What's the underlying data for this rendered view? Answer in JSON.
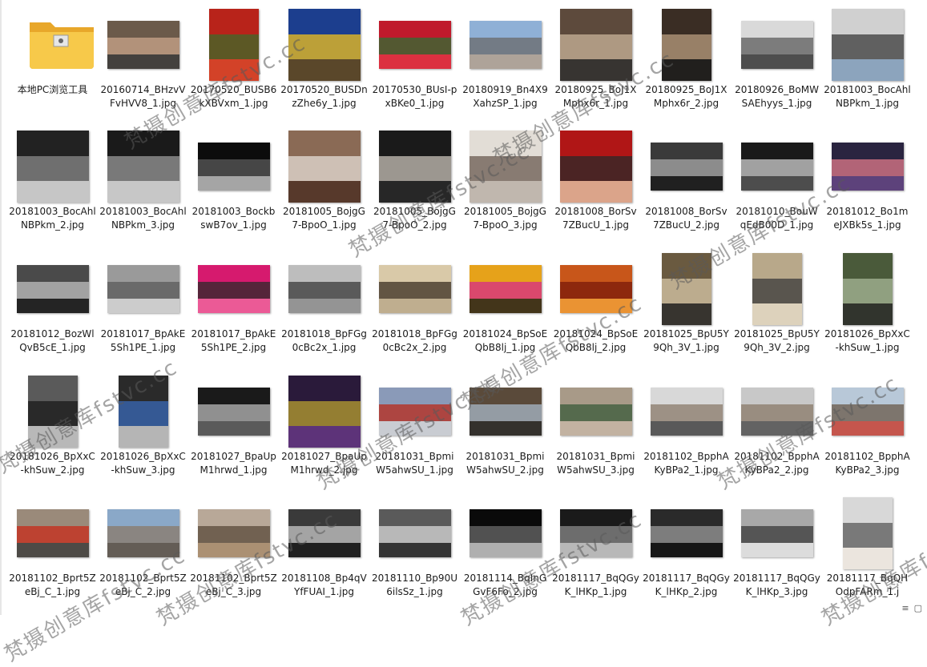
{
  "files": [
    {
      "label": "本地PC浏览工具",
      "kind": "folder"
    },
    {
      "label": "20160714_BHzvVFvHVV8_1.jpg",
      "colors": [
        "#6b5a4a",
        "#c9a58b",
        "#3b3b3b"
      ]
    },
    {
      "label": "20170520_BUSB6kXBVxm_1.jpg",
      "colors": [
        "#b8231a",
        "#3e6b2a",
        "#d94a2c"
      ]
    },
    {
      "label": "20170520_BUSDnzZhe6y_1.jpg",
      "colors": [
        "#1c3e8e",
        "#f2c21b",
        "#6a4a12"
      ]
    },
    {
      "label": "20170530_BUsI-pxBKe0_1.jpg",
      "colors": [
        "#c01a2c",
        "#2f6d33",
        "#e23646"
      ]
    },
    {
      "label": "20180919_Bn4X9XahzSP_1.jpg",
      "colors": [
        "#8fb0d6",
        "#6a6a6a",
        "#b5a089"
      ]
    },
    {
      "label": "20180925_BoJ1XMphx6r_1.jpg",
      "colors": [
        "#5d4a3c",
        "#c9b49a",
        "#2e2e2e"
      ]
    },
    {
      "label": "20180925_BoJ1XMphx6r_2.jpg",
      "colors": [
        "#3a2d24",
        "#b89c7e",
        "#1c1c1c"
      ]
    },
    {
      "label": "20180926_BoMWSAEhyys_1.jpg",
      "colors": [
        "#d9d9d9",
        "#5c5c5c",
        "#2a2a2a"
      ]
    },
    {
      "label": "20181003_BocAhlNBPkm_1.jpg",
      "colors": [
        "#d0d0d0",
        "#3b3b3b",
        "#7a98b8"
      ]
    },
    {
      "label": "20181003_BocAhlNBPkm_2.jpg",
      "colors": [
        "#222222",
        "#8a8a8a",
        "#f0f0f0"
      ]
    },
    {
      "label": "20181003_BocAhlNBPkm_3.jpg",
      "colors": [
        "#1a1a1a",
        "#9a9a9a",
        "#f2f2f2"
      ]
    },
    {
      "label": "20181003_BockbswB7ov_1.jpg",
      "colors": [
        "#0c0c0c",
        "#5a5a5a",
        "#cccccc"
      ]
    },
    {
      "label": "20181005_BojgG7-BpoO_1.jpg",
      "colors": [
        "#8a6a55",
        "#e4ddd5",
        "#4a2d20"
      ]
    },
    {
      "label": "20181005_BojgG7-BpoO_2.jpg",
      "colors": [
        "#1a1a1a",
        "#c8c2b8",
        "#2b2b2b"
      ]
    },
    {
      "label": "20181005_BojgG7-BpoO_3.jpg",
      "colors": [
        "#e2ddd6",
        "#6a5a50",
        "#b8aea4"
      ]
    },
    {
      "label": "20181008_BorSv7ZBucU_1.jpg",
      "colors": [
        "#b01616",
        "#2a2a2a",
        "#e6c8a8"
      ]
    },
    {
      "label": "20181008_BorSv7ZBucU_2.jpg",
      "colors": [
        "#3a3a3a",
        "#a8a8a8",
        "#1a1a1a"
      ]
    },
    {
      "label": "20181010_BouWqEdB00D_1.jpg",
      "colors": [
        "#1a1a1a",
        "#cfcfcf",
        "#5a5a5a"
      ]
    },
    {
      "label": "20181012_Bo1meJXBk5s_1.jpg",
      "colors": [
        "#2a2440",
        "#e07a8a",
        "#6a4a8a"
      ]
    },
    {
      "label": "20181012_BozWlQvB5cE_1.jpg",
      "colors": [
        "#4a4a4a",
        "#c0c0c0",
        "#1a1a1a"
      ]
    },
    {
      "label": "20181017_BpAkE5Sh1PE_1.jpg",
      "colors": [
        "#9a9a9a",
        "#5a5a5a",
        "#d8d8d8"
      ]
    },
    {
      "label": "20181017_BpAkE5Sh1PE_2.jpg",
      "colors": [
        "#d61a6e",
        "#2a2a2a",
        "#f06aa0"
      ]
    },
    {
      "label": "20181018_BpFGg0cBc2x_1.jpg",
      "colors": [
        "#bdbdbd",
        "#3a3a3a",
        "#8a8a8a"
      ]
    },
    {
      "label": "20181018_BpFGg0cBc2x_2.jpg",
      "colors": [
        "#d9c9a8",
        "#3a2e22",
        "#b8a888"
      ]
    },
    {
      "label": "20181024_BpSoEQbB8lj_1.jpg",
      "colors": [
        "#e6a21a",
        "#d62a8a",
        "#1a1a1a"
      ]
    },
    {
      "label": "20181024_BpSoEQbB8lj_2.jpg",
      "colors": [
        "#c8561a",
        "#7a1a0a",
        "#f2a23a"
      ]
    },
    {
      "label": "20181025_BpU5Y9Qh_3V_1.jpg",
      "colors": [
        "#6a5a40",
        "#d8c8a8",
        "#2a2a2a"
      ]
    },
    {
      "label": "20181025_BpU5Y9Qh_3V_2.jpg",
      "colors": [
        "#b8a88a",
        "#3a3a3a",
        "#e6dcc8"
      ]
    },
    {
      "label": "20181026_BpXxC-khSuw_1.jpg",
      "colors": [
        "#4a5a3a",
        "#a8b898",
        "#2a2a2a"
      ]
    },
    {
      "label": "20181026_BpXxC-khSuw_2.jpg",
      "colors": [
        "#5a5a5a",
        "#1a1a1a",
        "#cfcfcf"
      ]
    },
    {
      "label": "20181026_BpXxC-khSuw_3.jpg",
      "colors": [
        "#2a2a2a",
        "#3a6ab8",
        "#d8d8d8"
      ]
    },
    {
      "label": "20181027_BpaUpM1hrwd_1.jpg",
      "colors": [
        "#1a1a1a",
        "#b8b8b8",
        "#6a6a6a"
      ]
    },
    {
      "label": "20181027_BpaUpM1hrwd_2.jpg",
      "colors": [
        "#2a1a3a",
        "#b8a030",
        "#6a3a8a"
      ]
    },
    {
      "label": "20181031_BpmiW5ahwSU_1.jpg",
      "colors": [
        "#8a9ab8",
        "#b8281a",
        "#d8d8d8"
      ]
    },
    {
      "label": "20181031_BpmiW5ahwSU_2.jpg",
      "colors": [
        "#5a4a3a",
        "#a8b8c8",
        "#2a2a2a"
      ]
    },
    {
      "label": "20181031_BpmiW5ahwSU_3.jpg",
      "colors": [
        "#a89a88",
        "#3a5a3a",
        "#c8b8a8"
      ]
    },
    {
      "label": "20181102_BpphAKyBPa2_1.jpg",
      "colors": [
        "#d8d8d8",
        "#8a7a6a",
        "#3a3a3a"
      ]
    },
    {
      "label": "20181102_BpphAKyBPa2_2.jpg",
      "colors": [
        "#c8c8c8",
        "#8a7a68",
        "#4a4a4a"
      ]
    },
    {
      "label": "20181102_BpphAKyBPa2_3.jpg",
      "colors": [
        "#b8c8d8",
        "#6a5a4a",
        "#c83a2a"
      ]
    },
    {
      "label": "20181102_Bprt5ZeBj_C_1.jpg",
      "colors": [
        "#9a8a7a",
        "#c82a1a",
        "#3a3a3a"
      ]
    },
    {
      "label": "20181102_Bprt5ZeBj_C_2.jpg",
      "colors": [
        "#8aa8c8",
        "#8a7a6a",
        "#5a4a3a"
      ]
    },
    {
      "label": "20181102_Bprt5ZeBj_C_3.jpg",
      "colors": [
        "#b8a898",
        "#5a4a3a",
        "#a88a6a"
      ]
    },
    {
      "label": "20181108_Bp4qVYfFUAI_1.jpg",
      "colors": [
        "#3a3a3a",
        "#c8c8c8",
        "#1a1a1a"
      ]
    },
    {
      "label": "20181110_Bp90U6ilsSz_1.jpg",
      "colors": [
        "#5a5a5a",
        "#d8d8d8",
        "#2a2a2a"
      ]
    },
    {
      "label": "20181114_BqInGGvF6Fo_2.jpg",
      "colors": [
        "#0a0a0a",
        "#6a6a6a",
        "#d8d8d8"
      ]
    },
    {
      "label": "20181117_BqQGyK_lHKp_1.jpg",
      "colors": [
        "#1a1a1a",
        "#8a8a8a",
        "#e0e0e0"
      ]
    },
    {
      "label": "20181117_BqQGyK_lHKp_2.jpg",
      "colors": [
        "#2a2a2a",
        "#9a9a9a",
        "#111111"
      ]
    },
    {
      "label": "20181117_BqQGyK_lHKp_3.jpg",
      "colors": [
        "#a8a8a8",
        "#3a3a3a",
        "#e8e8e8"
      ]
    },
    {
      "label": "20181117_BqQHOdpFARm_1.j",
      "colors": [
        "#d8d8d8",
        "#5a5a5a",
        "#f0e8e0"
      ]
    }
  ],
  "watermark_text": "梵摄创意库fstvc.cc"
}
